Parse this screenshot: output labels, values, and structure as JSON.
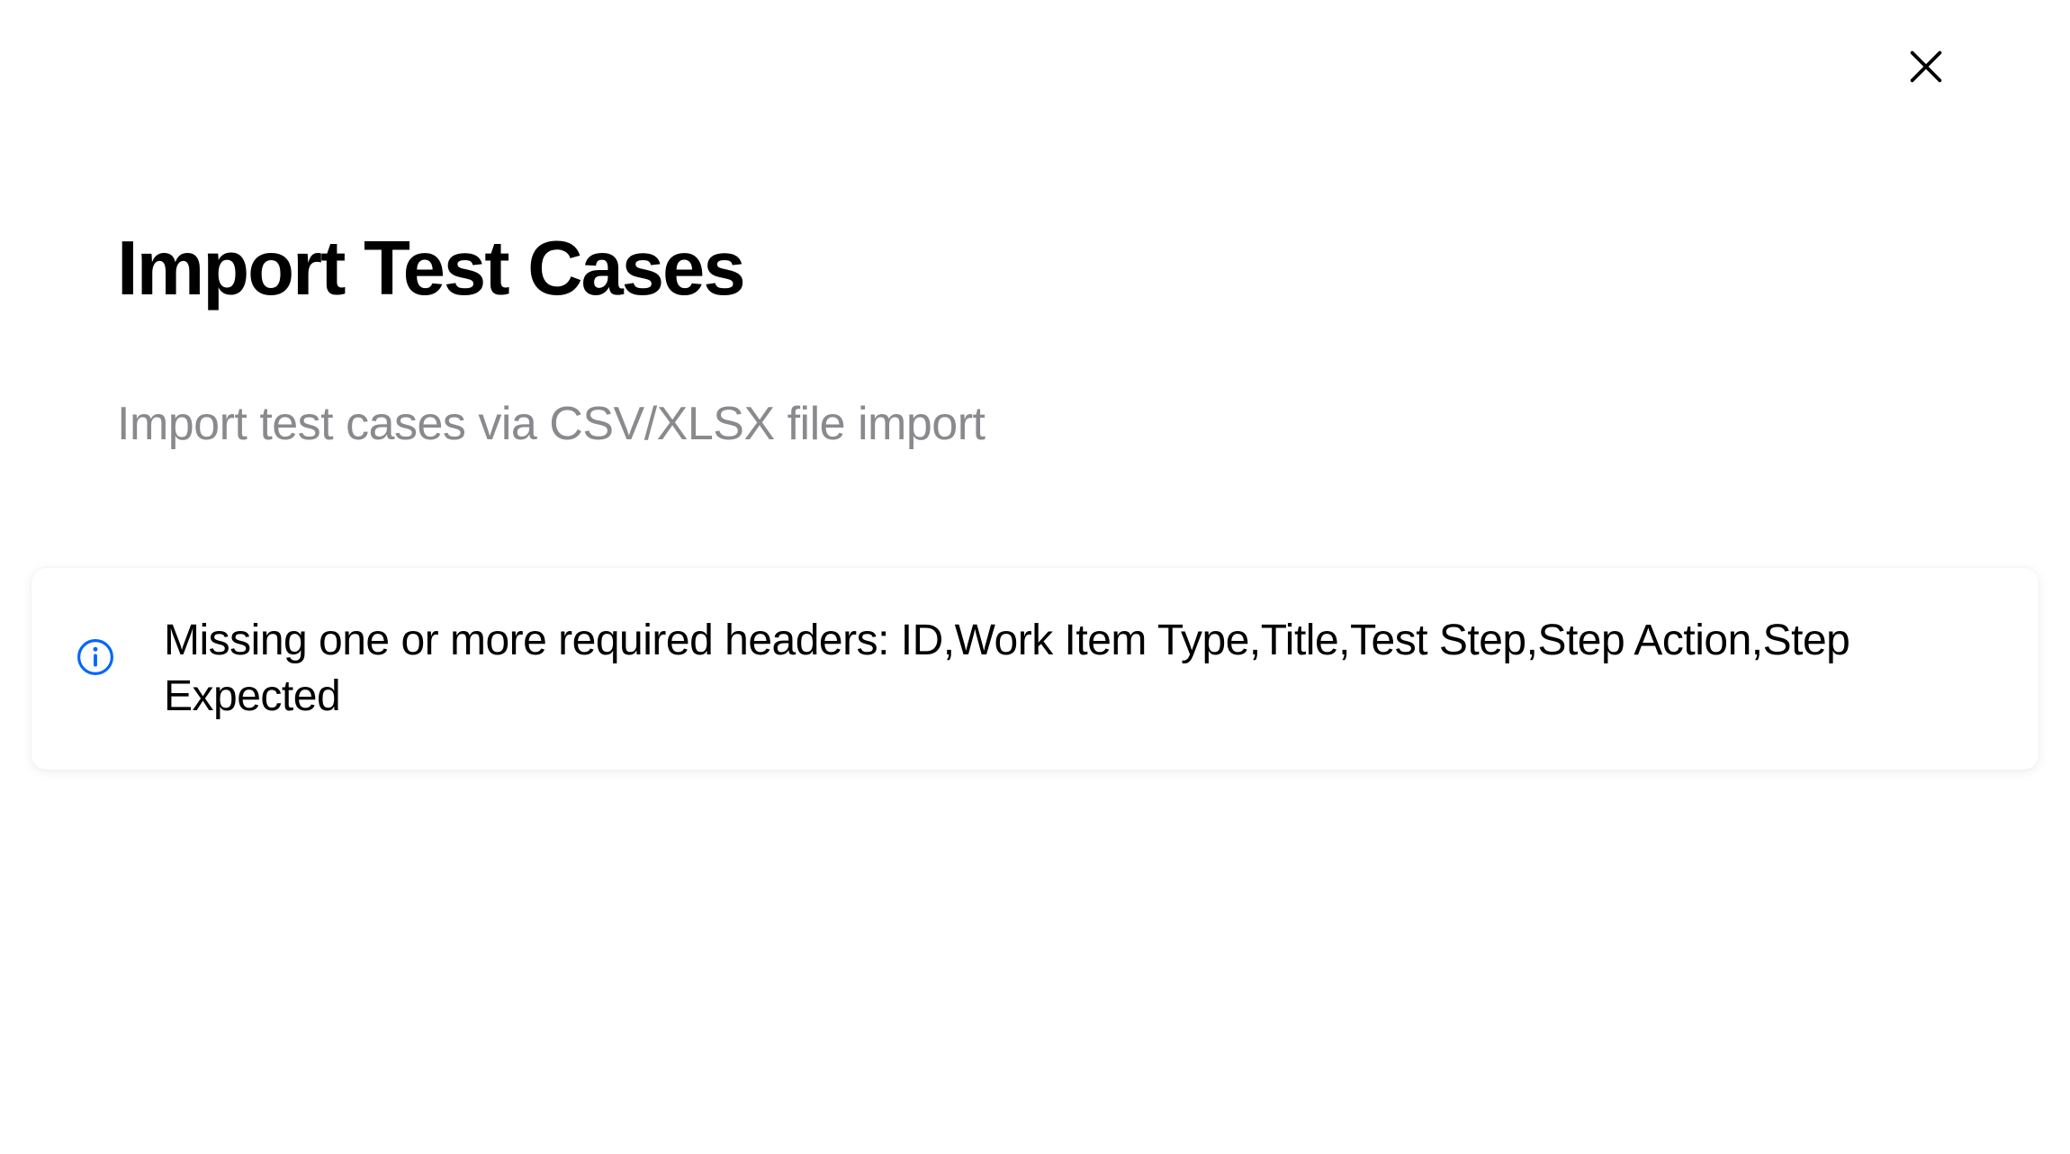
{
  "dialog": {
    "title": "Import Test Cases",
    "subtitle": "Import test cases via CSV/XLSX file import"
  },
  "alert": {
    "message": "Missing one or more required headers: ID,Work Item Type,Title,Test Step,Step Action,Step Expected"
  }
}
